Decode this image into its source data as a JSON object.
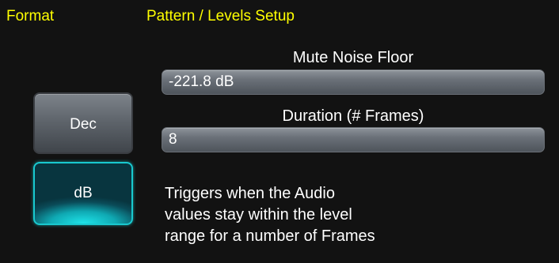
{
  "format": {
    "header": "Format",
    "buttons": {
      "dec": "Dec",
      "db": "dB"
    },
    "selected": "dB"
  },
  "pattern": {
    "header": "Pattern / Levels Setup",
    "mute_noise_floor": {
      "label": "Mute Noise Floor",
      "value": "-221.8 dB"
    },
    "duration": {
      "label": "Duration (# Frames)",
      "value": "8"
    },
    "description": [
      "Triggers when the Audio",
      "values stay within the level",
      "range for a number of Frames"
    ]
  },
  "colors": {
    "header": "#ffff00",
    "selected_accent": "#19c9cf",
    "background": "#121212"
  }
}
